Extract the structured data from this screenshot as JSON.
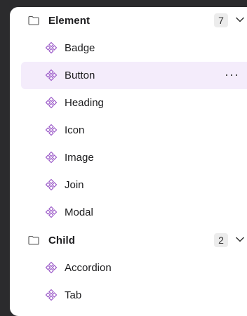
{
  "groups": [
    {
      "label": "Element",
      "count": "7",
      "items": [
        {
          "label": "Badge"
        },
        {
          "label": "Button",
          "selected": true
        },
        {
          "label": "Heading"
        },
        {
          "label": "Icon"
        },
        {
          "label": "Image"
        },
        {
          "label": "Join"
        },
        {
          "label": "Modal"
        }
      ]
    },
    {
      "label": "Child",
      "count": "2",
      "items": [
        {
          "label": "Accordion"
        },
        {
          "label": "Tab"
        }
      ]
    }
  ],
  "icons": {
    "group": "folder-icon",
    "item": "component-icon",
    "expand": "chevron-down-icon",
    "more": "more-horizontal-icon"
  },
  "more_label": "···",
  "colors": {
    "accent": "#9b59c8",
    "selected_bg": "#f4ecfb",
    "text": "#1d1d1f"
  }
}
